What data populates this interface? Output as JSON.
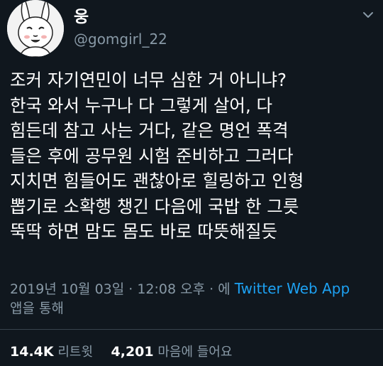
{
  "user": {
    "display_name": "웅",
    "handle": "@gomgirl_22"
  },
  "tweet": {
    "lines": [
      "조커 자기연민이 너무 심한 거 아니냐?",
      "한국 와서 누구나 다 그렇게 살어, 다",
      "힘든데 참고 사는 거다, 같은 명언 폭격",
      "들은 후에 공무원 시험 준비하고 그러다",
      "지치면 힘들어도 괜찮아로 힐링하고 인형",
      "뽑기로 소확행 챙긴 다음에 국밥 한 그릇",
      "뚝딱 하면 맘도 몸도 바로 따뜻해질듯"
    ]
  },
  "meta": {
    "timestamp": "2019년 10월 03일 · 12:08 오후 · 에 ",
    "source": "Twitter Web App",
    "suffix": "앱을 통해"
  },
  "stats": {
    "retweets_count": "14.4K",
    "retweets_label": "리트윗",
    "likes_count": "4,201",
    "likes_label": "마음에 들어요"
  },
  "icons": {
    "more": "chevron-down-icon",
    "avatar": "cartoon-rabbit-avatar"
  },
  "colors": {
    "background": "#10171e",
    "muted": "#8899a6",
    "link": "#1da1f2"
  }
}
